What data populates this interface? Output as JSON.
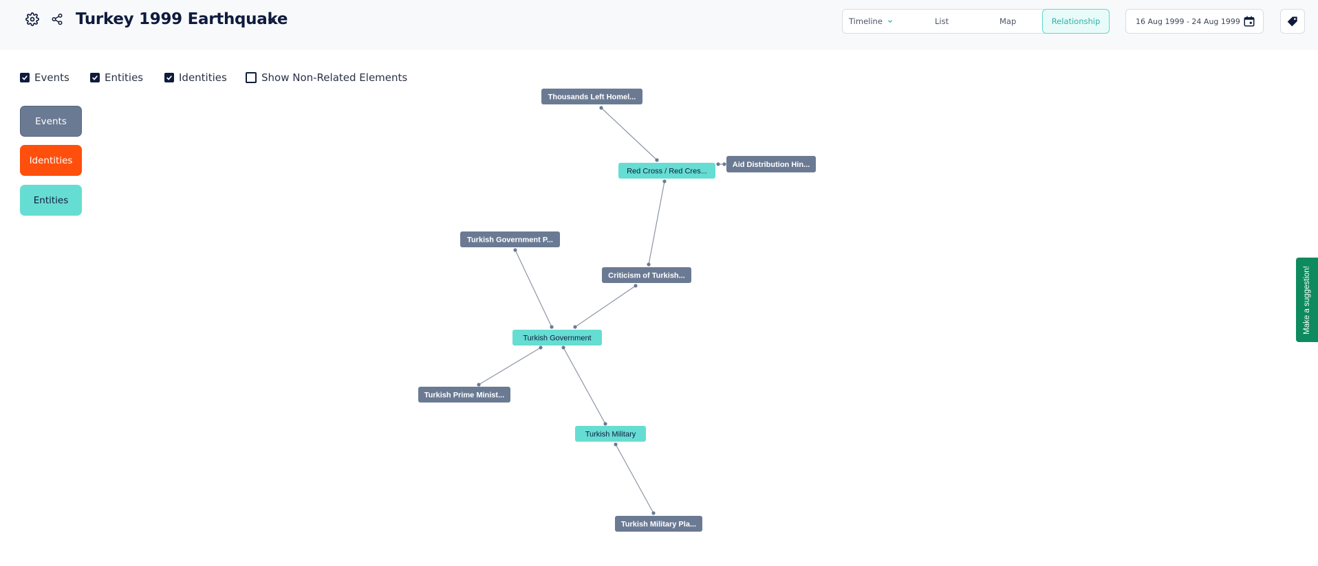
{
  "header": {
    "title": "Turkey 1999 Earthquake",
    "tabs": [
      {
        "label": "Timeline",
        "active": false,
        "has_dropdown": true
      },
      {
        "label": "List",
        "active": false
      },
      {
        "label": "Map",
        "active": false
      },
      {
        "label": "Relationship",
        "active": true
      }
    ],
    "date_range": "16 Aug 1999 - 24 Aug 1999",
    "icons": [
      "gear-icon",
      "share-icon",
      "chevron-down-icon",
      "calendar-icon",
      "tag-icon"
    ]
  },
  "filters": [
    {
      "label": "Events",
      "checked": true
    },
    {
      "label": "Entities",
      "checked": true
    },
    {
      "label": "Identities",
      "checked": true
    },
    {
      "label": "Show Non-Related Elements",
      "checked": false
    }
  ],
  "legend": [
    {
      "label": "Events",
      "color": "#6b7a93",
      "text_color": "#ffffff"
    },
    {
      "label": "Identities",
      "color": "#ff4f0c",
      "text_color": "#ffffff"
    },
    {
      "label": "Entities",
      "color": "#66ddd3",
      "text_color": "#0f1b3d"
    }
  ],
  "graph": {
    "nodes": [
      {
        "id": "n1",
        "label": "Thousands Left Homel...",
        "kind": "event"
      },
      {
        "id": "n2",
        "label": "Red Cross / Red Cres...",
        "kind": "entity"
      },
      {
        "id": "n3",
        "label": "Aid Distribution Hin...",
        "kind": "event"
      },
      {
        "id": "n4",
        "label": "Turkish Government P...",
        "kind": "event"
      },
      {
        "id": "n5",
        "label": "Criticism of Turkish...",
        "kind": "event"
      },
      {
        "id": "n6",
        "label": "Turkish Government",
        "kind": "entity"
      },
      {
        "id": "n7",
        "label": "Turkish Prime Minist...",
        "kind": "event"
      },
      {
        "id": "n8",
        "label": "Turkish Military",
        "kind": "entity"
      },
      {
        "id": "n9",
        "label": "Turkish Military Pla...",
        "kind": "event"
      }
    ],
    "edges": [
      [
        "n1",
        "n2"
      ],
      [
        "n2",
        "n3"
      ],
      [
        "n2",
        "n5"
      ],
      [
        "n4",
        "n6"
      ],
      [
        "n5",
        "n6"
      ],
      [
        "n6",
        "n7"
      ],
      [
        "n6",
        "n8"
      ],
      [
        "n8",
        "n9"
      ]
    ],
    "colors": {
      "event": "#6b7a93",
      "entity": "#66ddd3",
      "edge": "#8b93a3"
    }
  },
  "suggestion_button": "Make a suggestion!"
}
